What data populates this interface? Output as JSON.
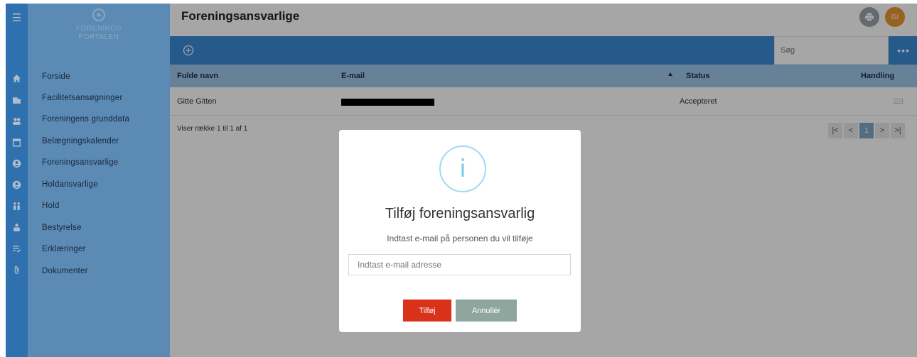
{
  "header": {
    "title": "Foreningsansvarlige",
    "avatar_initials": "GI"
  },
  "logo": {
    "line1": "FORENINGS",
    "line2": "PORTALEN"
  },
  "sidebar": {
    "items": [
      {
        "label": "Forside",
        "icon": "home-icon"
      },
      {
        "label": "Facilitetsansøgninger",
        "icon": "building-icon"
      },
      {
        "label": "Foreningens grunddata",
        "icon": "users-icon"
      },
      {
        "label": "Belægningskalender",
        "icon": "calendar-icon"
      },
      {
        "label": "Foreningsansvarlige",
        "icon": "user-circle-icon"
      },
      {
        "label": "Holdansvarlige",
        "icon": "user-circle-icon"
      },
      {
        "label": "Hold",
        "icon": "team-icon"
      },
      {
        "label": "Bestyrelse",
        "icon": "board-icon"
      },
      {
        "label": "Erklæringer",
        "icon": "checklist-icon"
      },
      {
        "label": "Dokumenter",
        "icon": "paperclip-icon"
      }
    ]
  },
  "toolbar": {
    "search_placeholder": "Søg",
    "more_label": "•••"
  },
  "table": {
    "columns": [
      "Fulde navn",
      "E-mail",
      "Status",
      "Handling"
    ],
    "rows": [
      {
        "name": "Gitte Gitten",
        "status": "Accepteret"
      }
    ]
  },
  "pager": {
    "info": "Viser række 1 til 1 af 1",
    "first": "|<",
    "prev": "<",
    "page": "1",
    "next": ">",
    "last": ">|"
  },
  "modal": {
    "title": "Tilføj foreningsansvarlig",
    "text": "Indtast e-mail på personen du vil tilføje",
    "input_placeholder": "Indtast e-mail adresse",
    "add_label": "Tilføj",
    "cancel_label": "Annullér"
  },
  "colors": {
    "primary": "#3a8ad6",
    "sidebar": "#6fa9dc",
    "table_header": "#9fc6ec",
    "danger": "#d9321a",
    "cancel": "#8ea69e",
    "avatar": "#e7972f",
    "info": "#7ccbea"
  }
}
